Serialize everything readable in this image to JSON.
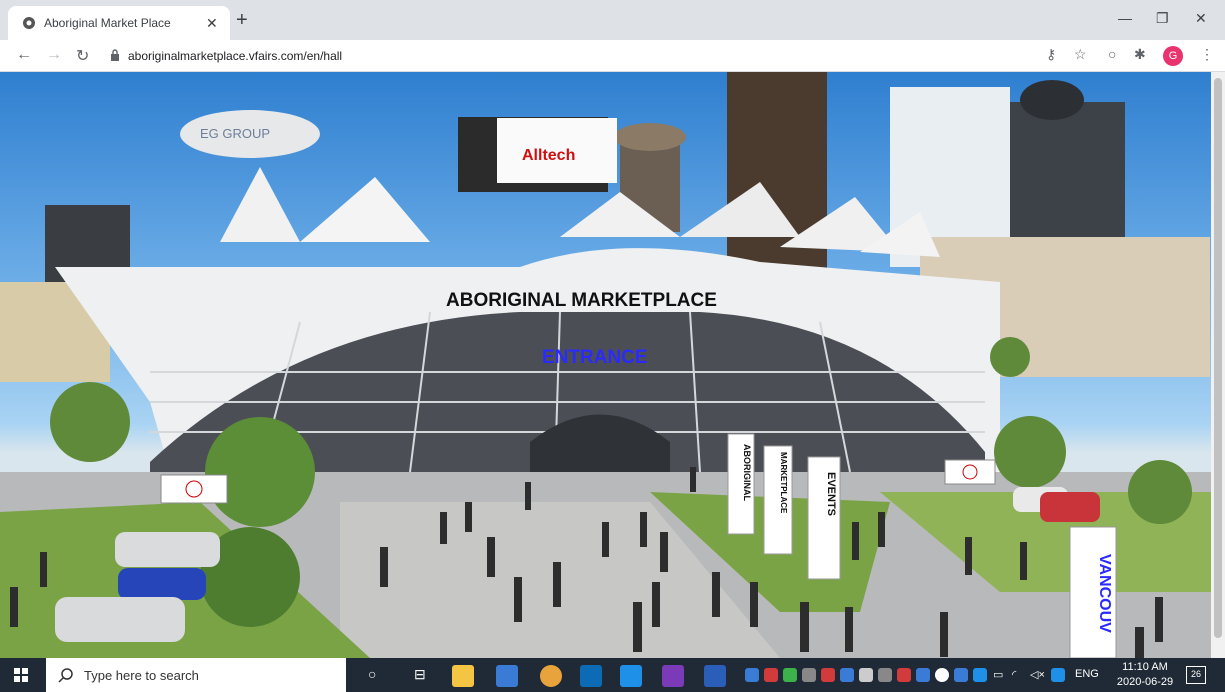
{
  "browser": {
    "tab_title": "Aboriginal Market Place",
    "url": "aboriginalmarketplace.vfairs.com/en/hall",
    "profile_initial": "G"
  },
  "scene": {
    "blimp_text": "EG GROUP",
    "billboard_text": "Alltech",
    "building_title": "ABORIGINAL MARKETPLACE",
    "entrance_text": "ENTRANCE",
    "banner_1": "ABORIGINAL",
    "banner_2": "MARKETPLACE",
    "banner_3": "EVENTS",
    "banner_4": "VANCOUV"
  },
  "taskbar": {
    "search_placeholder": "Type here to search",
    "language": "ENG",
    "time": "11:10 AM",
    "date": "2020-06-29",
    "notification_count": "26"
  },
  "colors": {
    "taskbar_bg": "#1f2a36",
    "tab_strip": "#dee1e6",
    "entrance_blue": "#2a2aff"
  }
}
